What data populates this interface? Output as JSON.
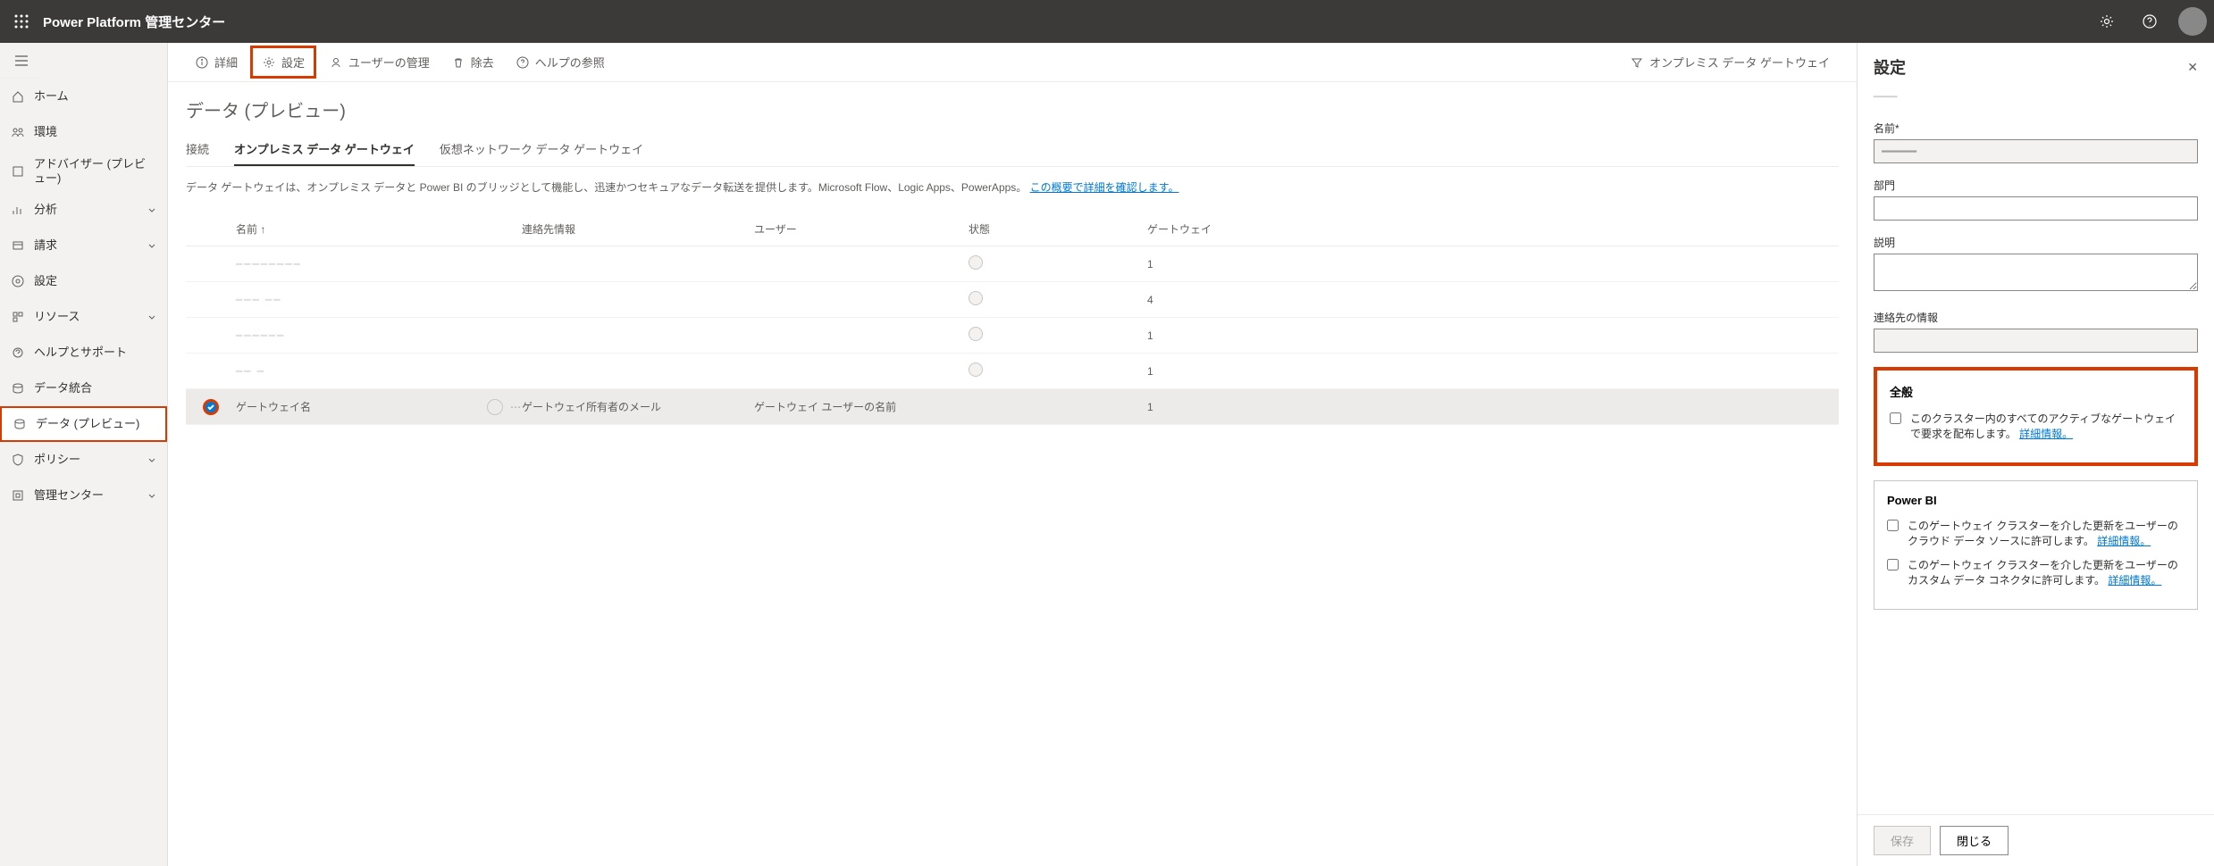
{
  "header": {
    "title": "Power Platform 管理センター"
  },
  "sidebar": {
    "items": [
      {
        "label": "ホーム"
      },
      {
        "label": "環境"
      },
      {
        "label": "アドバイザー (プレビュー)"
      },
      {
        "label": "分析",
        "chevron": true
      },
      {
        "label": "請求",
        "chevron": true
      },
      {
        "label": "設定"
      },
      {
        "label": "リソース",
        "chevron": true
      },
      {
        "label": "ヘルプとサポート"
      },
      {
        "label": "データ統合"
      },
      {
        "label": "データ (プレビュー)",
        "selected": true
      },
      {
        "label": "ポリシー",
        "chevron": true
      },
      {
        "label": "管理センター",
        "chevron": true
      }
    ]
  },
  "commandBar": {
    "items": [
      {
        "label": "詳細"
      },
      {
        "label": "設定",
        "highlighted": true
      },
      {
        "label": "ユーザーの管理"
      },
      {
        "label": "除去"
      },
      {
        "label": "ヘルプの参照"
      }
    ],
    "rightLabel": "オンプレミス データ ゲートウェイ"
  },
  "page": {
    "title": "データ (プレビュー)",
    "tabs": [
      {
        "label": "接続"
      },
      {
        "label": "オンプレミス データ ゲートウェイ",
        "active": true
      },
      {
        "label": "仮想ネットワーク データ ゲートウェイ"
      }
    ],
    "description": "データ ゲートウェイは、オンプレミス データと Power BI のブリッジとして機能し、迅速かつセキュアなデータ転送を提供します。Microsoft Flow、Logic Apps、PowerApps。",
    "descriptionLink": "この概要で詳細を確認します。"
  },
  "table": {
    "columns": {
      "name": "名前  ↑",
      "contact": "連絡先情報",
      "user": "ユーザー",
      "state": "状態",
      "gateway": "ゲートウェイ"
    },
    "rows": [
      {
        "gateway": "1"
      },
      {
        "gateway": "4"
      },
      {
        "gateway": "1"
      },
      {
        "gateway": "1"
      },
      {
        "selected": true,
        "name": "ゲートウェイ名",
        "contact": "ゲートウェイ所有者のメール",
        "user": "ゲートウェイ ユーザーの名前",
        "gateway": "1"
      }
    ]
  },
  "panel": {
    "title": "設定",
    "ghost": "━━━━",
    "name_label": "名前*",
    "name_value": "━━━━━",
    "dept_label": "部門",
    "desc_label": "説明",
    "contact_label": "連絡先の情報",
    "general": {
      "title": "全般",
      "checkbox": "このクラスター内のすべてのアクティブなゲートウェイで要求を配布します。",
      "link": "詳細情報。"
    },
    "powerbi": {
      "title": "Power BI",
      "check1": "このゲートウェイ クラスターを介した更新をユーザーのクラウド データ ソースに許可します。",
      "link1": "詳細情報。",
      "check2": "このゲートウェイ クラスターを介した更新をユーザーのカスタム データ コネクタに許可します。",
      "link2": "詳細情報。"
    },
    "save": "保存",
    "close": "閉じる"
  }
}
